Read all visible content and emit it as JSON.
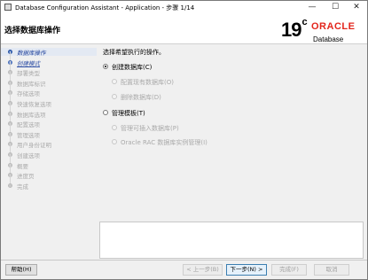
{
  "window": {
    "title": "Database Configuration Assistant - Application - 步骤 1/14",
    "minimize_glyph": "—",
    "maximize_glyph": "☐",
    "close_glyph": "✕"
  },
  "header": {
    "page_title": "选择数据库操作",
    "logo_version": "19",
    "logo_version_sup": "c",
    "logo_brand": "ORACLE",
    "logo_product": "Database"
  },
  "nav": {
    "steps": [
      {
        "label": "数据库操作",
        "state": "active"
      },
      {
        "label": "创建模式",
        "state": "link"
      },
      {
        "label": "部署类型",
        "state": "disabled"
      },
      {
        "label": "数据库标识",
        "state": "disabled"
      },
      {
        "label": "存储选项",
        "state": "disabled"
      },
      {
        "label": "快速恢复选项",
        "state": "disabled"
      },
      {
        "label": "数据库选项",
        "state": "disabled"
      },
      {
        "label": "配置选项",
        "state": "disabled"
      },
      {
        "label": "管理选项",
        "state": "disabled"
      },
      {
        "label": "用户身份证明",
        "state": "disabled"
      },
      {
        "label": "创建选项",
        "state": "disabled"
      },
      {
        "label": "概要",
        "state": "disabled"
      },
      {
        "label": "进度页",
        "state": "disabled"
      },
      {
        "label": "完成",
        "state": "disabled"
      }
    ]
  },
  "main": {
    "prompt": "选择希望执行的操作。",
    "options": {
      "create_db": {
        "label": "创建数据库(C)",
        "selected": true,
        "enabled": true
      },
      "config_existing": {
        "label": "配置现有数据库(O)",
        "selected": false,
        "enabled": false
      },
      "delete_db": {
        "label": "删除数据库(D)",
        "selected": false,
        "enabled": false
      },
      "manage_templates": {
        "label": "管理模板(T)",
        "selected": false,
        "enabled": true
      },
      "manage_pdb": {
        "label": "管理可插入数据库(P)",
        "selected": false,
        "enabled": false
      },
      "rac_instance": {
        "label": "Oracle RAC 数据库实例管理(I)",
        "selected": false,
        "enabled": false
      }
    }
  },
  "footer": {
    "help_label": "帮助(H)",
    "back_label": "< 上一步(B)",
    "next_label": "下一步(N) >",
    "finish_label": "完成(F)",
    "cancel_label": "取消"
  }
}
